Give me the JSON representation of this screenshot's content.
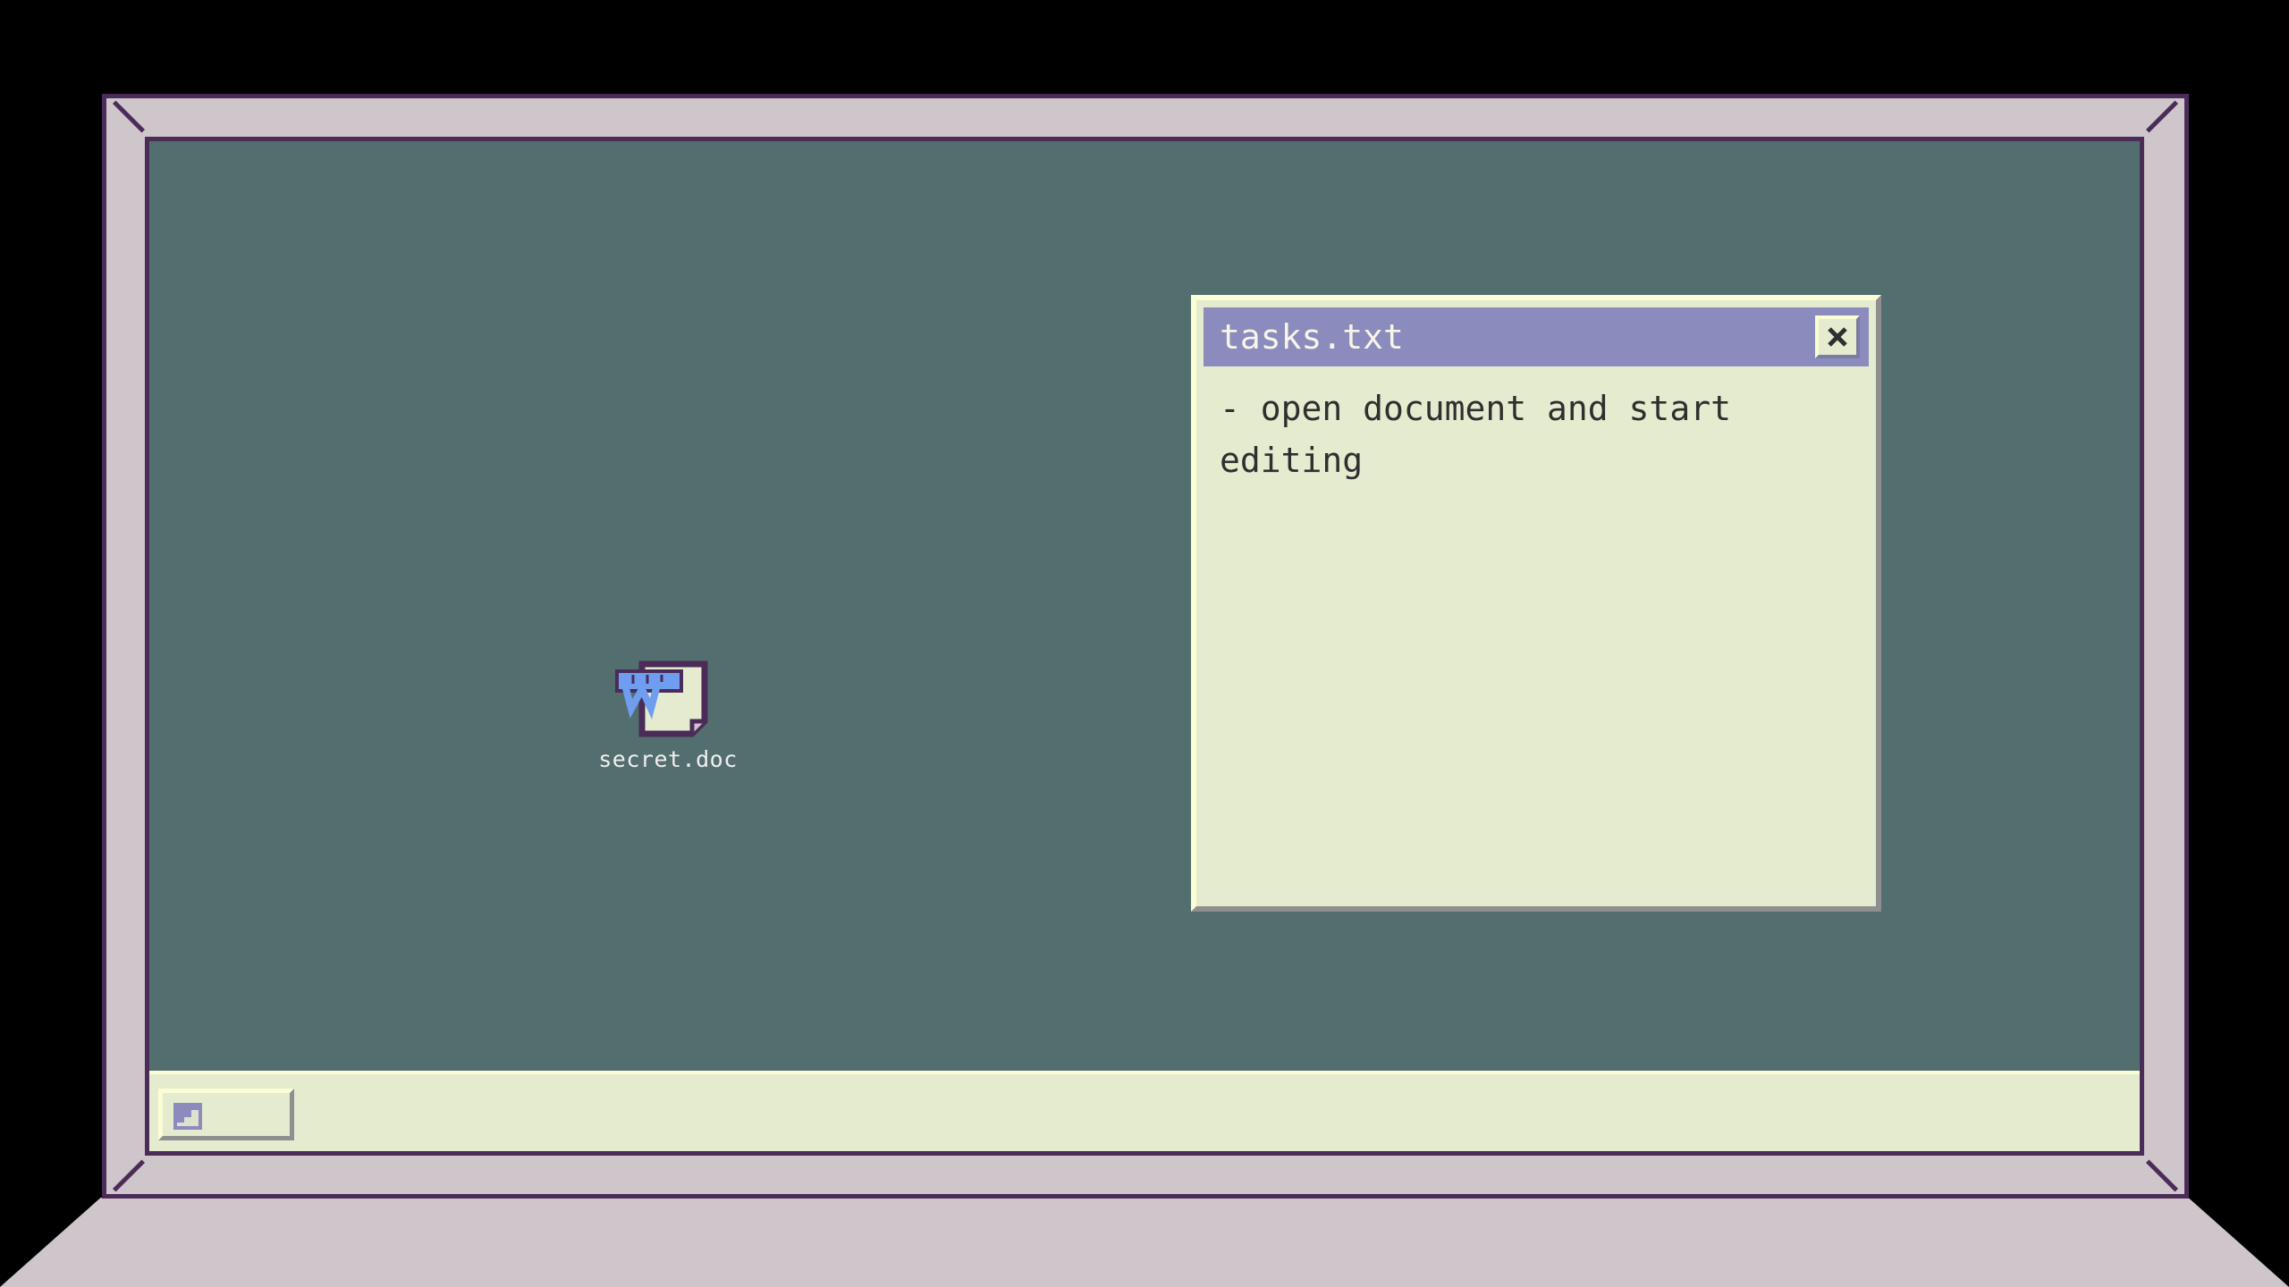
{
  "desktop": {
    "icons": [
      {
        "label": "secret.doc",
        "icon": "word-document-icon"
      }
    ]
  },
  "window": {
    "title": "tasks.txt",
    "content": "- open document and start\nediting",
    "close_icon": "close-icon"
  },
  "taskbar": {
    "start_icon": "start-menu-icon"
  },
  "colors": {
    "desktop": "#536e6e",
    "titlebar": "#8b8bbd",
    "window": "#e5ebcf",
    "bezel": "#cfc6cc",
    "outline": "#4b2b58"
  }
}
